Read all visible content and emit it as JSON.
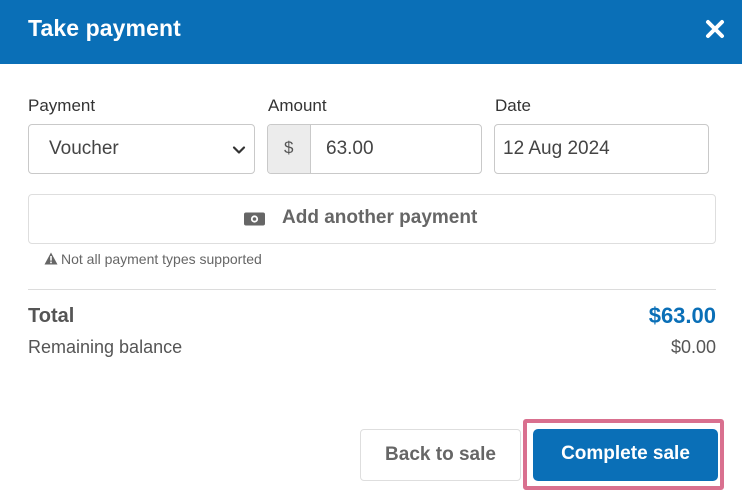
{
  "header": {
    "title": "Take payment",
    "close_icon": "close-icon"
  },
  "payment": {
    "label": "Payment",
    "selected": "Voucher"
  },
  "amount": {
    "label": "Amount",
    "prefix": "$",
    "value": "63.00"
  },
  "date": {
    "label": "Date",
    "value": "12 Aug 2024"
  },
  "add_payment": {
    "icon": "cash-icon",
    "label": "Add another payment"
  },
  "note": {
    "icon": "warning-icon",
    "text": "Not all payment types supported"
  },
  "summary": {
    "total_label": "Total",
    "total_value": "$63.00",
    "remaining_label": "Remaining balance",
    "remaining_value": "$0.00"
  },
  "actions": {
    "back_label": "Back to sale",
    "complete_label": "Complete sale"
  },
  "colors": {
    "brand": "#0a6fb7",
    "highlight": "#d9708f"
  }
}
